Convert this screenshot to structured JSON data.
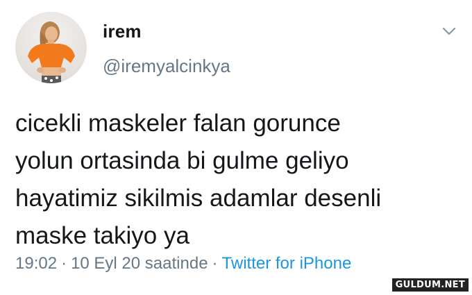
{
  "user": {
    "display_name": "irem",
    "handle": "@iremyalcinkya"
  },
  "tweet": {
    "text": "cicekli maskeler falan gorunce\nyolun ortasinda bi gulme geliyo\nhayatimiz sikilmis adamlar desenli\nmaske takiyo ya"
  },
  "meta": {
    "time": "19:02",
    "separator": "·",
    "date": "10 Eyl 20 saatinde",
    "source": "Twitter for iPhone"
  },
  "icons": {
    "menu": "chevron-down-icon"
  },
  "colors": {
    "text": "#14171a",
    "secondary": "#657786",
    "link": "#1b95e0",
    "avatar_shirt": "#f07a1c"
  },
  "watermark": "GULDUM.NET"
}
